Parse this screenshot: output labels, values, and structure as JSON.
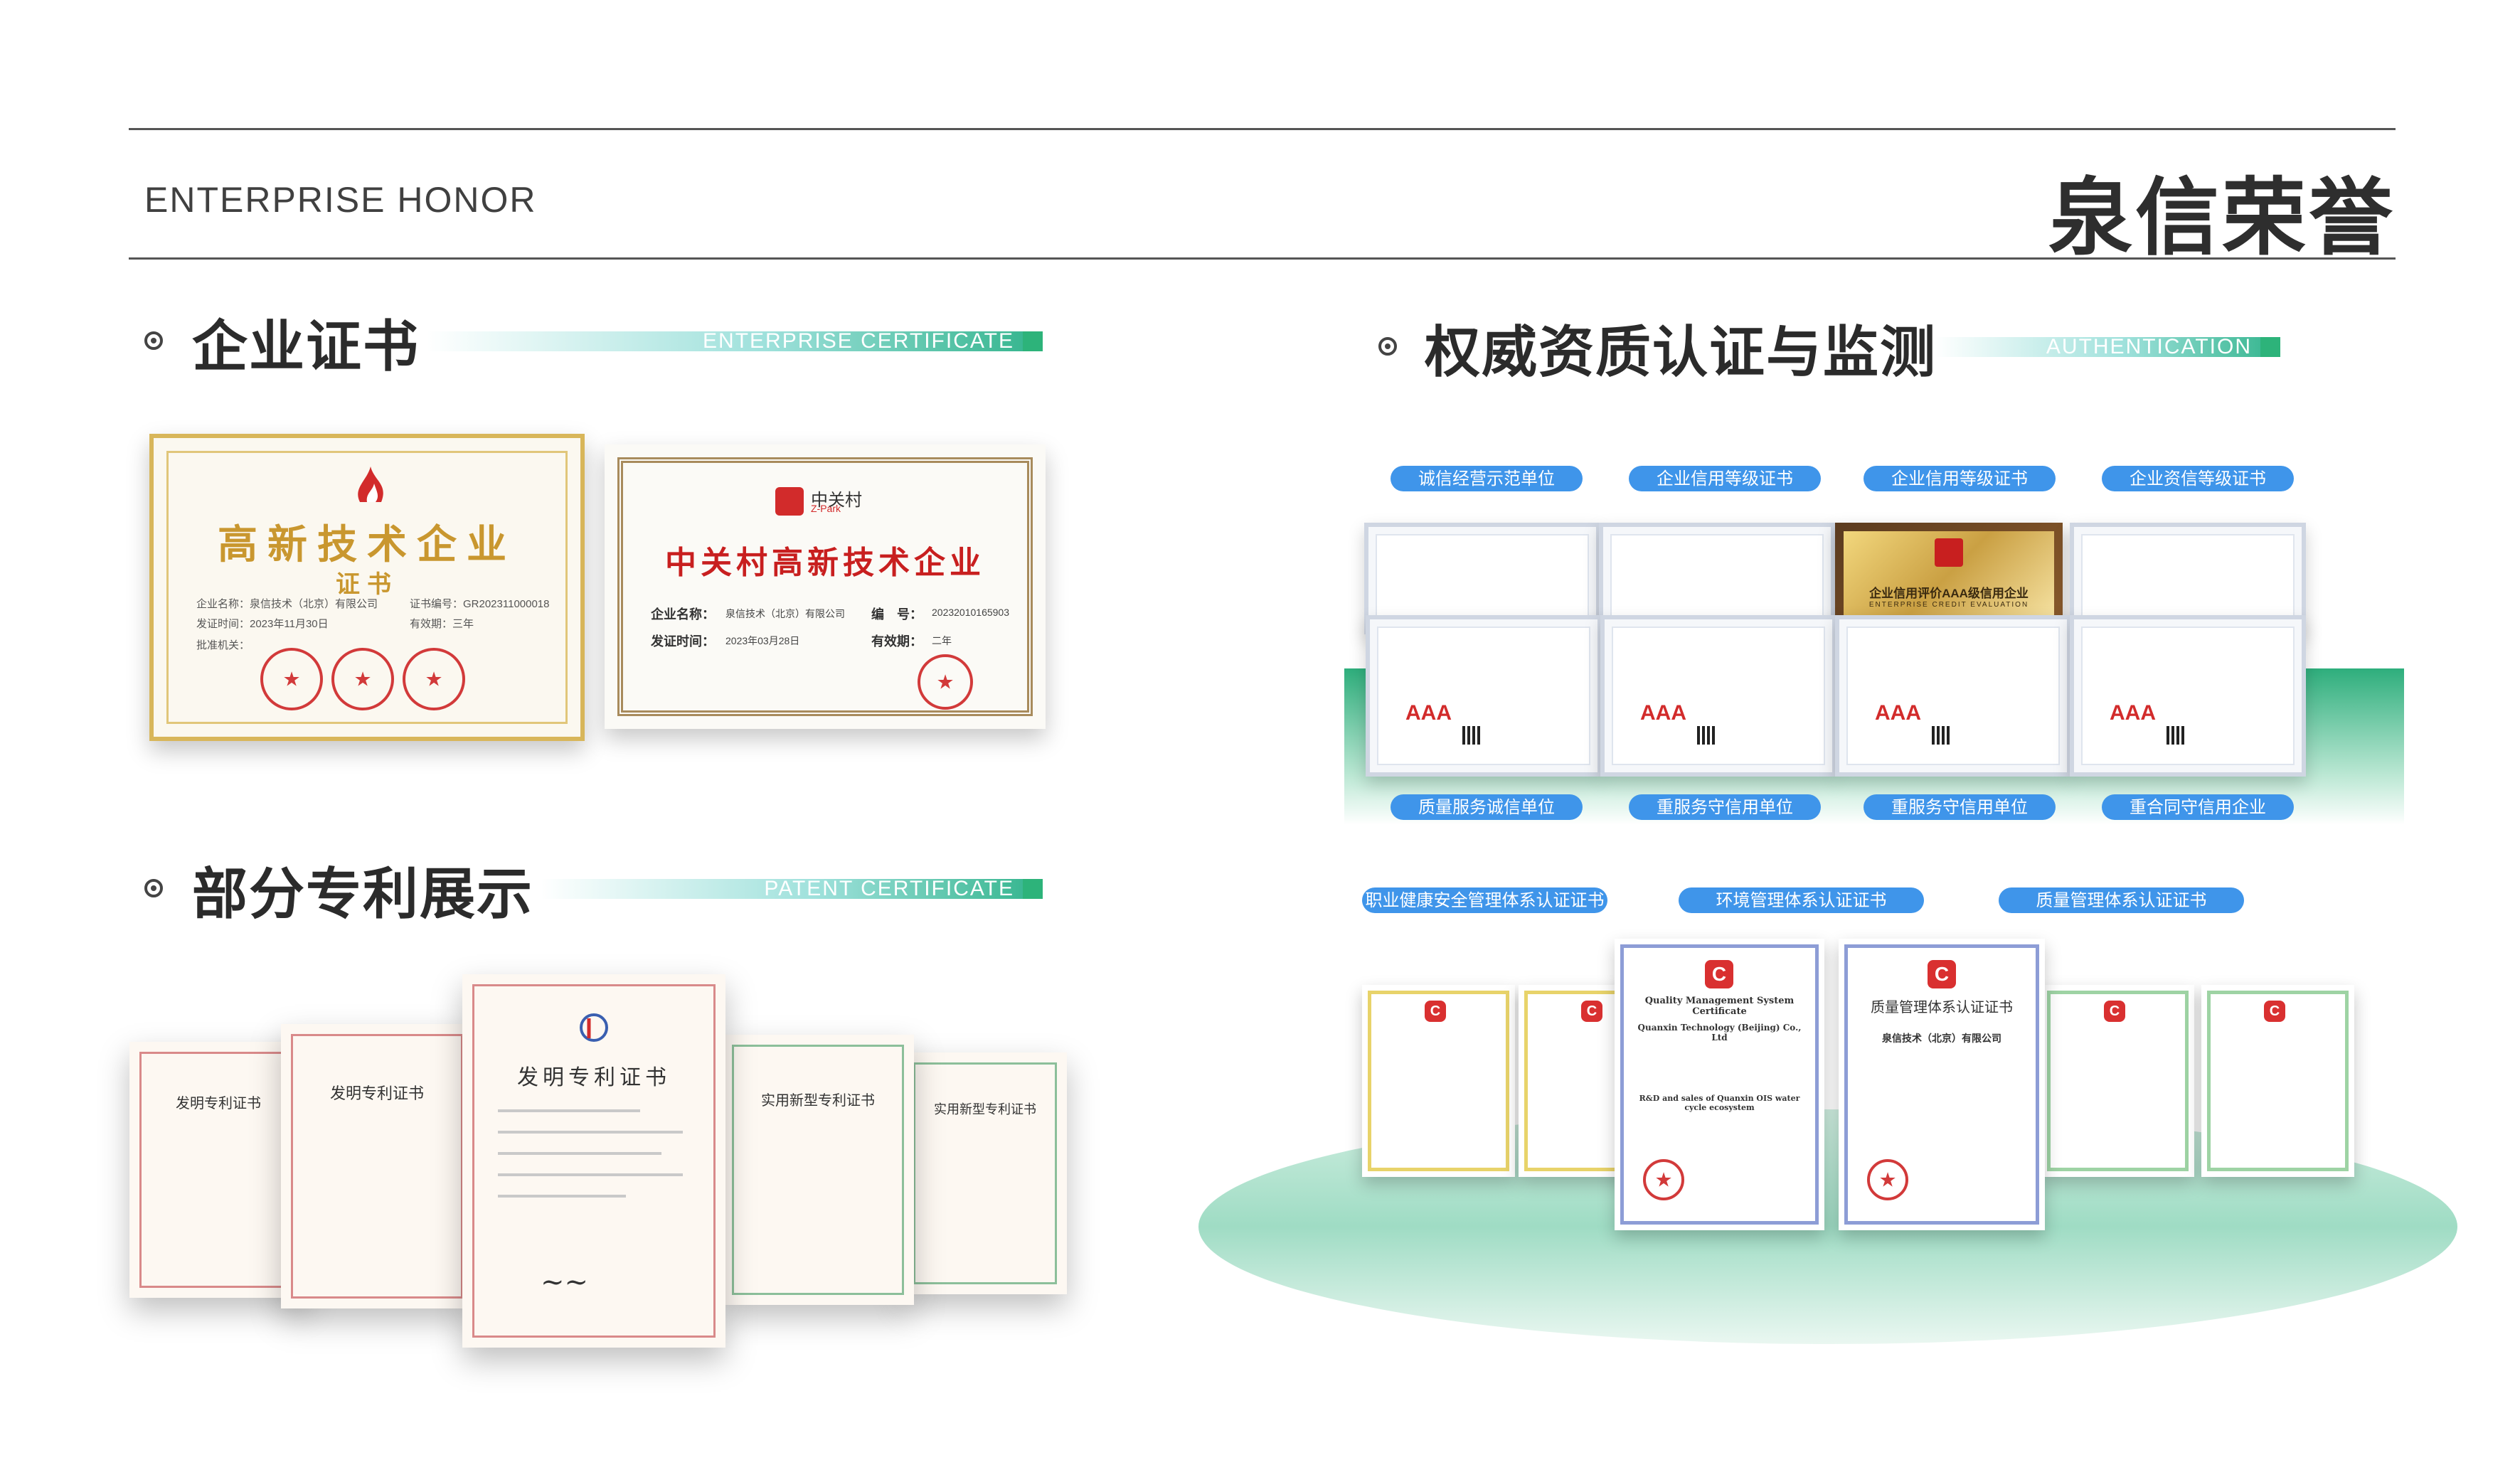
{
  "header": {
    "title_en": "ENTERPRISE HONOR",
    "title_cn": "泉信荣誉"
  },
  "sections": {
    "enterprise": {
      "title": "企业证书",
      "subtitle": "ENTERPRISE CERTIFICATE"
    },
    "authentication": {
      "title": "权威资质认证与监测",
      "subtitle": "AUTHENTICATION"
    },
    "patent": {
      "title": "部分专利展示",
      "subtitle": "PATENT CERTIFICATE"
    }
  },
  "enterprise_certs": {
    "gold": {
      "title": "高新技术企业",
      "sub": "证书",
      "rows": [
        "企业名称：泉信技术（北京）有限公司",
        "发证时间：2023年11月30日",
        "证书编号：GR202311000018",
        "有效期：三年",
        "批准机关："
      ]
    },
    "zgc": {
      "logo": "中关村",
      "logo_en": "Z-Park",
      "title": "中关村高新技术企业",
      "rows": [
        "企业名称：",
        "泉信技术（北京）有限公司",
        "编　号：",
        "20232010165903",
        "发证时间：",
        "2023年03月28日",
        "有效期：",
        "二年"
      ]
    }
  },
  "auth_top_badges": [
    "诚信经营示范单位",
    "企业信用等级证书",
    "企业信用等级证书",
    "企业资信等级证书"
  ],
  "auth_bottom_badges": [
    "质量服务诚信单位",
    "重服务守信用单位",
    "重服务守信用单位",
    "重合同守信用企业"
  ],
  "auth_plaque": {
    "title": "企业信用评价AAA级信用企业",
    "sub": "ENTERPRISE CREDIT EVALUATION"
  },
  "aaa_label": "AAA",
  "iso_badges": [
    "职业健康安全管理体系认证证书",
    "环境管理体系认证证书",
    "质量管理体系认证证书"
  ],
  "iso_certs": {
    "qms_en": {
      "title": "Quality Management System Certificate",
      "company": "Quanxin Technology (Beijing) Co., Ltd",
      "scope": "R&D and sales of Quanxin OIS water cycle ecosystem"
    },
    "qms_cn": {
      "title": "质量管理体系认证证书",
      "company": "泉信技术（北京）有限公司"
    }
  },
  "patents": {
    "invention": "发明专利证书",
    "utility": "实用新型专利证书"
  }
}
